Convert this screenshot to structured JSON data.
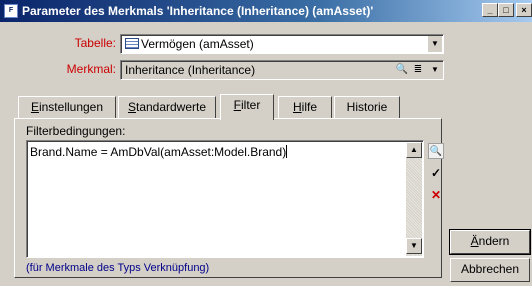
{
  "window": {
    "title": "Parameter des Merkmals 'Inheritance (Inheritance) (amAsset)'",
    "buttons": {
      "minimize": "_",
      "maximize": "□",
      "close": "×"
    }
  },
  "fields": {
    "table_label": "Tabelle:",
    "table_value": "Vermögen (amAsset)",
    "feature_label": "Merkmal:",
    "feature_value": "Inheritance (Inheritance)"
  },
  "tabs": [
    {
      "label": "Einstellungen",
      "mnemonic": "E",
      "rest": "instellungen"
    },
    {
      "label": "Standardwerte",
      "mnemonic": "S",
      "rest": "tandardwerte"
    },
    {
      "label": "Filter",
      "mnemonic": "F",
      "rest": "ilter",
      "active": true
    },
    {
      "label": "Hilfe",
      "mnemonic": "H",
      "rest": "ilfe"
    },
    {
      "label": "Historie",
      "mnemonic": "",
      "rest": "Historie"
    }
  ],
  "filter": {
    "section_label": "Filterbedingungen:",
    "expression": "Brand.Name = AmDbVal(amAsset:Model.Brand)",
    "hint": "(für Merkmale des Typs Verknüpfung)"
  },
  "actions": {
    "change_mnemonic": "Ä",
    "change_rest": "ndern",
    "cancel_label": "Abbrechen"
  },
  "icons": {
    "app": "merkmal-icon",
    "search": "magnifier-icon",
    "check": "checkmark-icon",
    "delete": "red-x-icon"
  }
}
